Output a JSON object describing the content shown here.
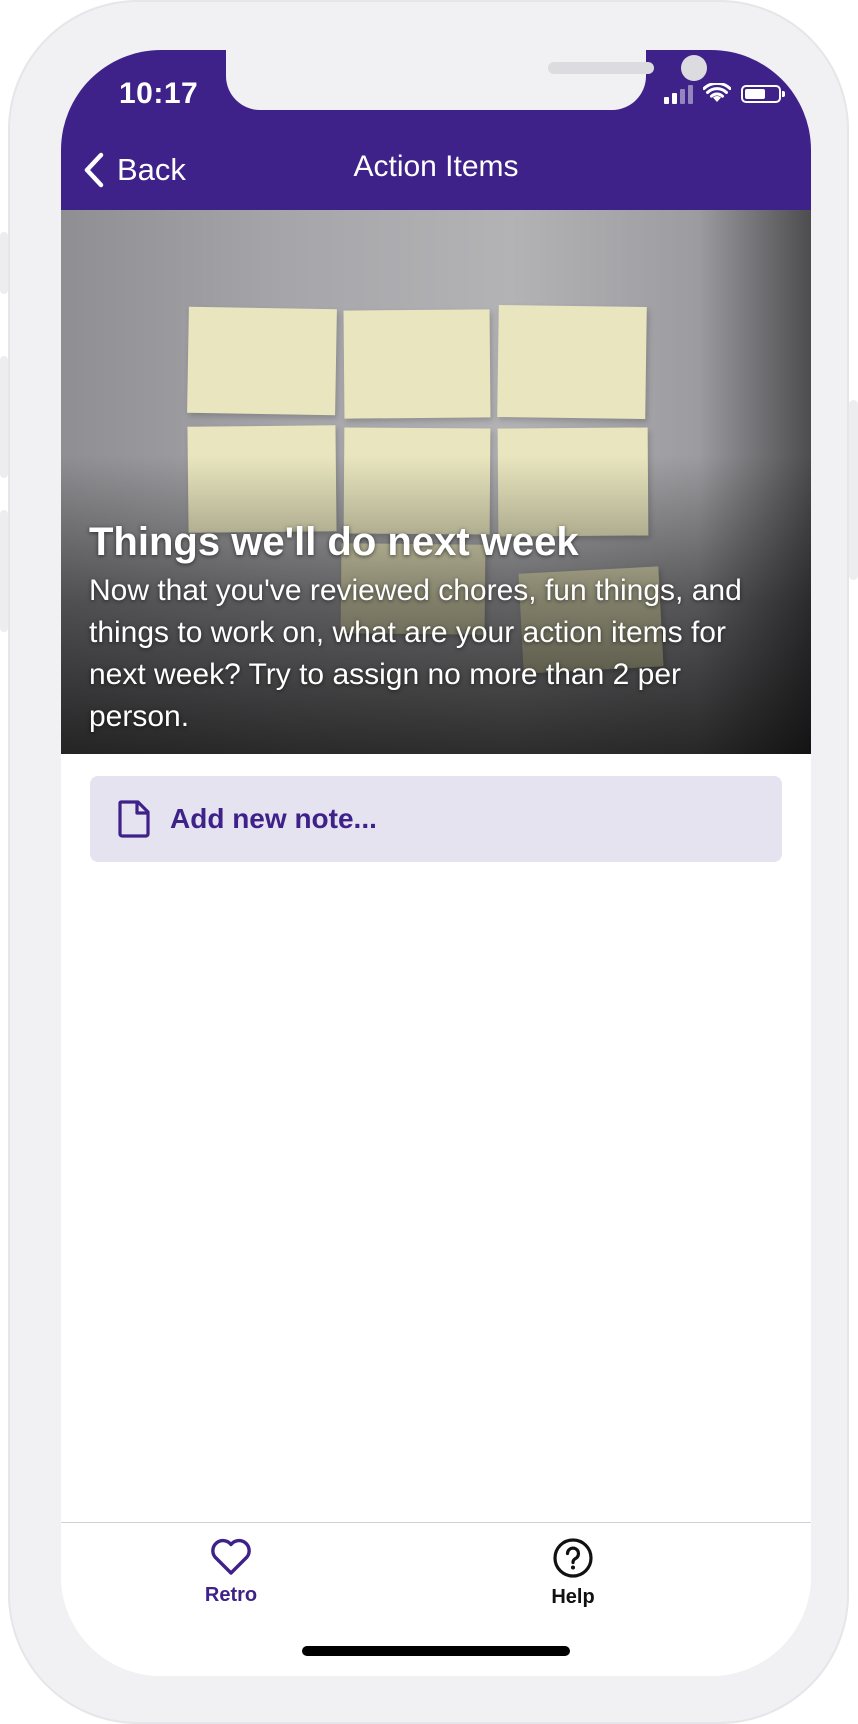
{
  "status_bar": {
    "time": "10:17"
  },
  "nav": {
    "back_label": "Back",
    "title": "Action Items"
  },
  "hero": {
    "title": "Things we'll do next week",
    "text": "Now that you've reviewed chores, fun things, and things to work on, what are your action items for next week? Try to assign no more than 2 per person."
  },
  "add_note": {
    "label": "Add new note..."
  },
  "tabs": [
    {
      "label": "Retro",
      "icon": "heart-icon",
      "active": true
    },
    {
      "label": "Help",
      "icon": "help-circle-icon",
      "active": false
    }
  ],
  "colors": {
    "brand": "#3e2289",
    "add_note_bg": "#e6e3f0",
    "sticky_note": "#e9e6bf"
  }
}
